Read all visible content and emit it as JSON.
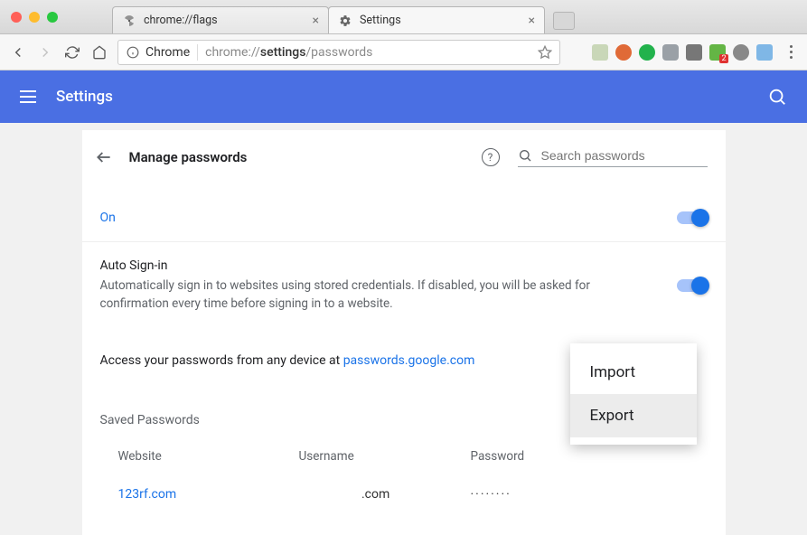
{
  "window": {
    "tabs": [
      {
        "title": "chrome://flags"
      },
      {
        "title": "Settings"
      }
    ]
  },
  "omnibox": {
    "host_label": "Chrome",
    "path_prefix": "chrome://",
    "path_bold": "settings",
    "path_suffix": "/passwords"
  },
  "header": {
    "title": "Settings"
  },
  "page": {
    "title": "Manage passwords",
    "search_placeholder": "Search passwords",
    "on_label": "On",
    "auto_signin": {
      "title": "Auto Sign-in",
      "desc": "Automatically sign in to websites using stored credentials. If disabled, you will be asked for confirmation every time before signing in to a website."
    },
    "access_text": "Access your passwords from any device at ",
    "access_link": "passwords.google.com",
    "saved_title": "Saved Passwords",
    "columns": {
      "website": "Website",
      "username": "Username",
      "password": "Password"
    },
    "rows": [
      {
        "site": "123rf.com",
        "username_suffix": ".com",
        "password_mask": "········"
      }
    ],
    "popup": {
      "import": "Import",
      "export": "Export"
    }
  }
}
